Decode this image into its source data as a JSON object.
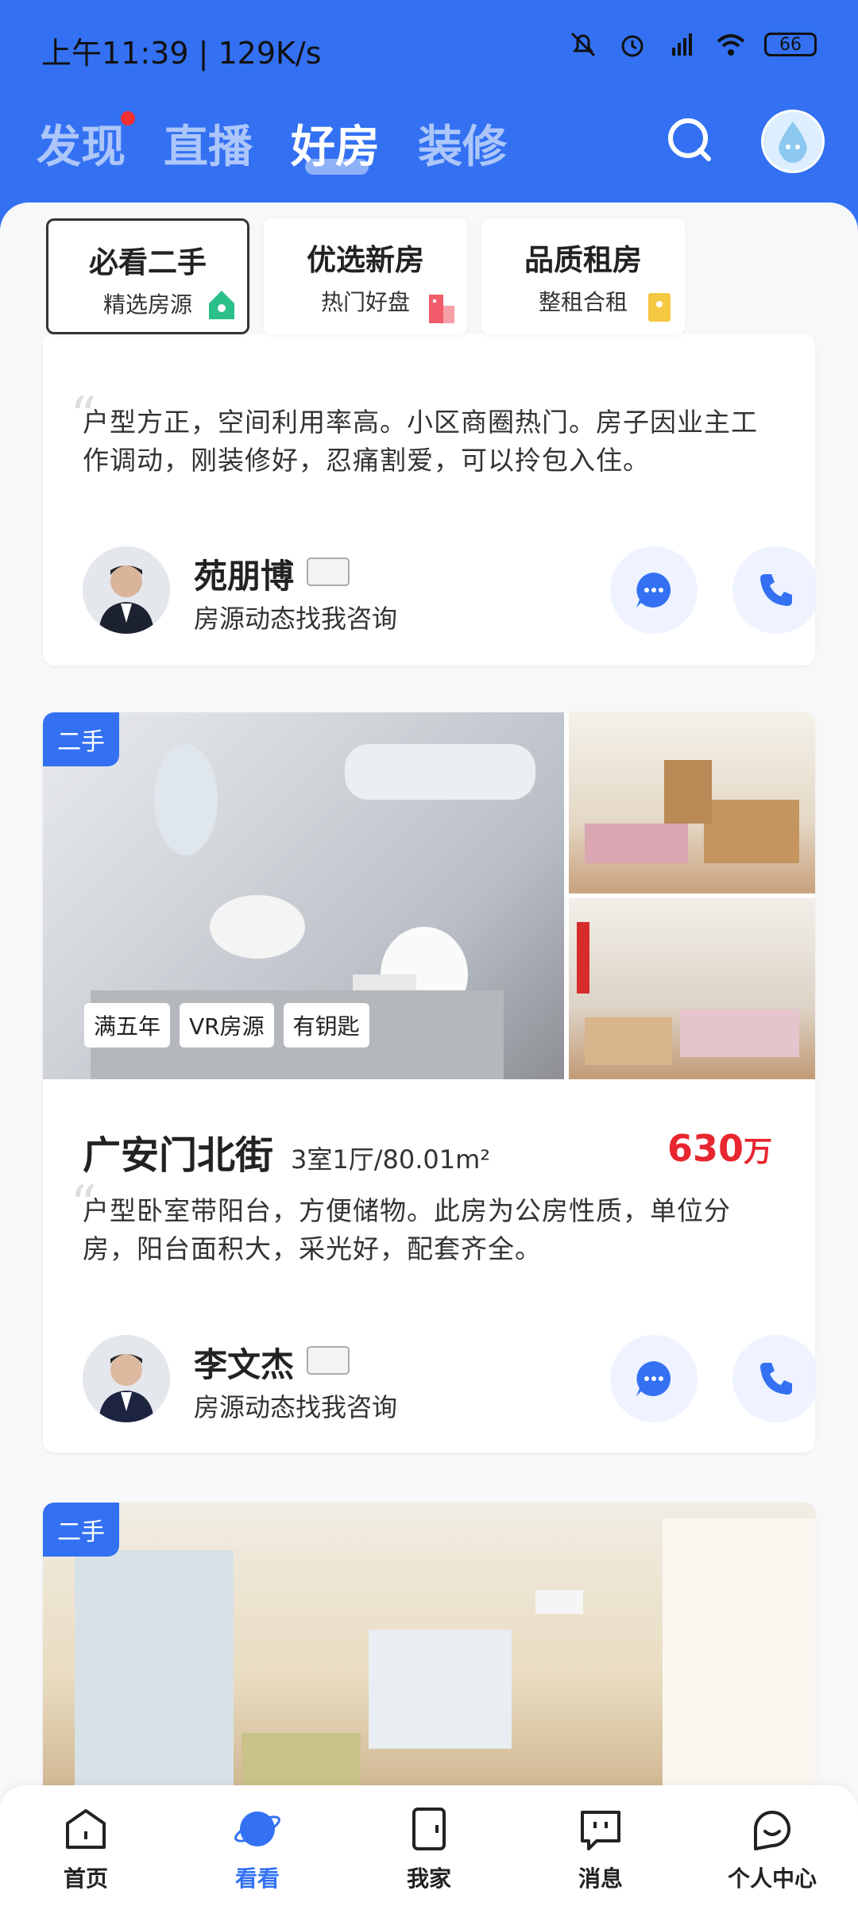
{
  "status": {
    "time": "上午11:39 | 129K/s",
    "battery": "66"
  },
  "top_tabs": [
    {
      "label": "发现",
      "has_dot": true
    },
    {
      "label": "直播"
    },
    {
      "label": "好房",
      "active": true
    },
    {
      "label": "装修"
    }
  ],
  "categories": [
    {
      "title": "必看二手",
      "subtitle": "精选房源",
      "icon": "house-icon",
      "color": "#2bbf8a",
      "active": true
    },
    {
      "title": "优选新房",
      "subtitle": "热门好盘",
      "icon": "building-icon",
      "color": "#f25c6a"
    },
    {
      "title": "品质租房",
      "subtitle": "整租合租",
      "icon": "key-doc-icon",
      "color": "#f5c842"
    }
  ],
  "card1": {
    "description": "户型方正，空间利用率高。小区商圈热门。房子因业主工作调动，刚装修好，忍痛割爱，可以拎包入住。",
    "agent": {
      "name": "苑朋博",
      "subtitle": "房源动态找我咨询"
    }
  },
  "card2": {
    "badge": "二手",
    "tags": [
      "满五年",
      "VR房源",
      "有钥匙"
    ],
    "title": "广安门北街",
    "meta": "3室1厅/80.01m²",
    "price": "630",
    "price_unit": "万",
    "description": "户型卧室带阳台，方便储物。此房为公房性质，单位分房，阳台面积大，采光好，配套齐全。",
    "agent": {
      "name": "李文杰",
      "subtitle": "房源动态找我咨询"
    }
  },
  "card3": {
    "badge": "二手"
  },
  "bottom_nav": [
    {
      "label": "首页",
      "icon": "home-icon"
    },
    {
      "label": "看看",
      "icon": "planet-icon",
      "active": true
    },
    {
      "label": "我家",
      "icon": "door-icon"
    },
    {
      "label": "消息",
      "icon": "message-icon"
    },
    {
      "label": "个人中心",
      "icon": "smile-icon"
    }
  ],
  "colors": {
    "brand_blue": "#3371f2",
    "price_red": "#e8262f"
  }
}
